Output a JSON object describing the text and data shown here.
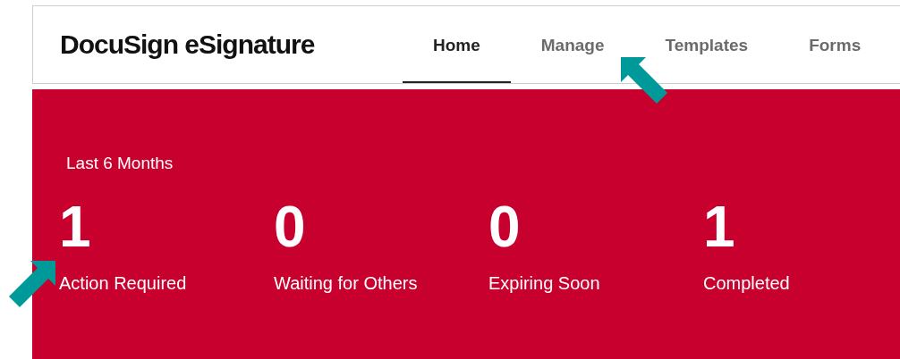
{
  "header": {
    "logo": "DocuSign eSignature",
    "tabs": [
      {
        "label": "Home",
        "selected": true
      },
      {
        "label": "Manage",
        "selected": false
      },
      {
        "label": "Templates",
        "selected": false
      },
      {
        "label": "Forms",
        "selected": false
      }
    ]
  },
  "summary": {
    "period": "Last 6 Months",
    "stats": [
      {
        "count": "1",
        "label": "Action Required"
      },
      {
        "count": "0",
        "label": "Waiting for Others"
      },
      {
        "count": "0",
        "label": "Expiring Soon"
      },
      {
        "count": "1",
        "label": "Completed"
      }
    ]
  }
}
